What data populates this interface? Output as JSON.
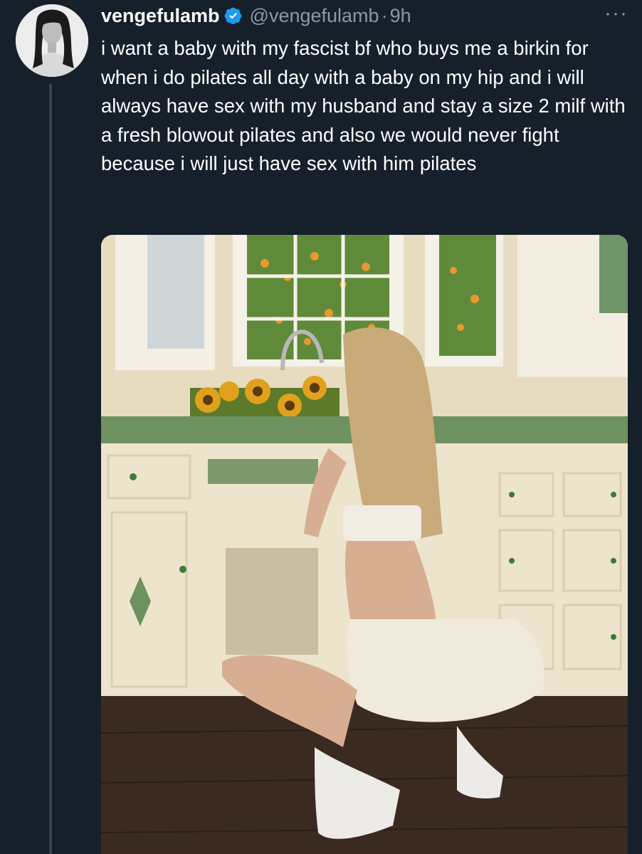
{
  "tweet": {
    "display_name": "vengefulamb",
    "handle": "@vengefulamb",
    "separator": "·",
    "time": "9h",
    "more_label": "···",
    "verified": true,
    "text": "i want a baby with my fascist bf who buys me a birkin for when i do pilates all day with a baby on my hip and i will always have sex with my husband and stay a size 2 milf with a fresh blowout pilates and also we would never fight because i will just have sex with him pilates"
  },
  "colors": {
    "background": "#15202b",
    "text": "#ffffff",
    "secondary": "#8b98a5",
    "verified": "#1d9bf0",
    "thread_line": "#38444d"
  },
  "icons": {
    "verified": "verified-badge-icon",
    "more": "more-dots-icon"
  }
}
